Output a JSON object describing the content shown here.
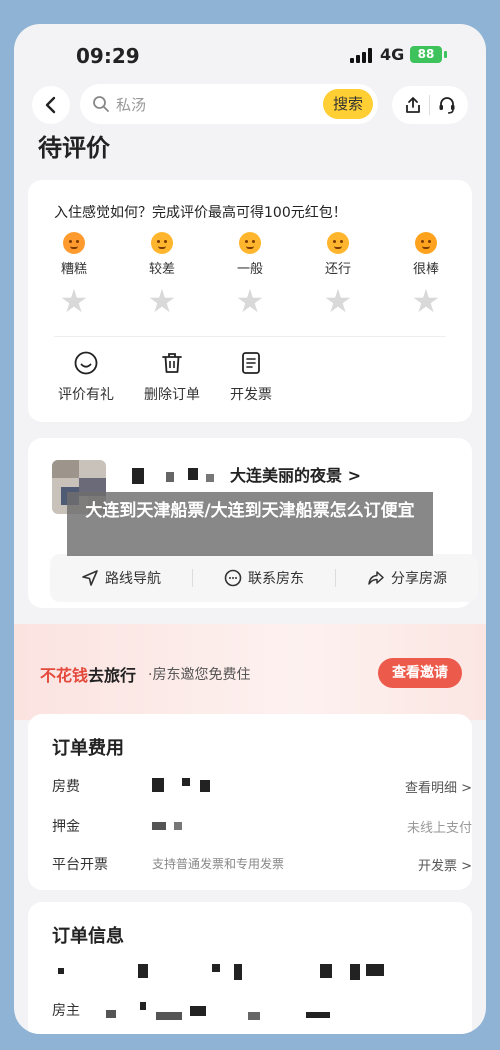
{
  "status": {
    "time": "09:29",
    "network": "4G",
    "battery": "88"
  },
  "nav": {
    "search_placeholder": "私汤",
    "search_button": "搜索"
  },
  "page_title": "待评价",
  "review": {
    "prompt": "入住感觉如何？完成评价最高可得100元红包！",
    "ratings": [
      "糟糕",
      "较差",
      "一般",
      "还行",
      "很棒"
    ],
    "actions": [
      {
        "label": "评价有礼",
        "icon": "smile-icon"
      },
      {
        "label": "删除订单",
        "icon": "trash-icon"
      },
      {
        "label": "开发票",
        "icon": "invoice-icon"
      }
    ]
  },
  "hotel": {
    "name": "大连美丽的夜景 >",
    "actions": [
      {
        "label": "路线导航",
        "icon": "navigation-icon"
      },
      {
        "label": "联系房东",
        "icon": "chat-icon"
      },
      {
        "label": "分享房源",
        "icon": "share-icon"
      }
    ]
  },
  "overlay_title": "大连到天津船票/大连到天津船票怎么订便宜",
  "promo": {
    "highlight_red": "不花钱",
    "highlight_dark": "去旅行",
    "subtitle": "·房东邀您免费住",
    "button": "查看邀请"
  },
  "fees": {
    "title": "订单费用",
    "rows": [
      {
        "label": "房费",
        "middle": "",
        "right": "查看明细 >"
      },
      {
        "label": "押金",
        "middle": "",
        "right": "未线上支付"
      },
      {
        "label": "平台开票",
        "middle": "支持普通发票和专用发票",
        "right": "开发票 >"
      }
    ]
  },
  "order_info": {
    "title": "订单信息",
    "row_label": "房主"
  },
  "colors": {
    "accent_yellow": "#ffcf33",
    "promo_red": "#ec5a4c",
    "background": "#8fb3d4"
  }
}
